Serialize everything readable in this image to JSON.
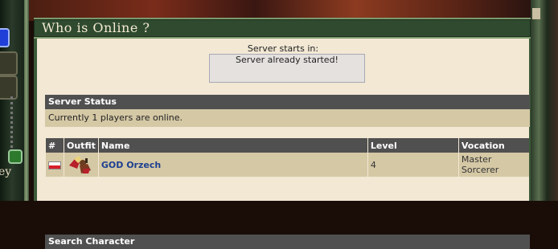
{
  "header": {
    "title": "Who is Online ?"
  },
  "sidebar": {
    "edge_text": "ey"
  },
  "server": {
    "starts_label": "Server starts in:",
    "status_text": "Server already started!"
  },
  "server_status": {
    "heading": "Server Status",
    "text": "Currently 1 players are online."
  },
  "players_table": {
    "columns": [
      "#",
      "Outfit",
      "Name",
      "Level",
      "Vocation"
    ],
    "rows": [
      {
        "flag": "poland-flag",
        "name": "GOD Orzech",
        "level": "4",
        "vocation": "Master Sorcerer"
      }
    ]
  },
  "search": {
    "heading": "Search Character"
  },
  "colors": {
    "header_green": "#2f4a2f",
    "content_bg": "#f2e8d4",
    "row_bg": "#d5c8a5",
    "head_bg": "#505050",
    "link": "#1c3f8f"
  }
}
